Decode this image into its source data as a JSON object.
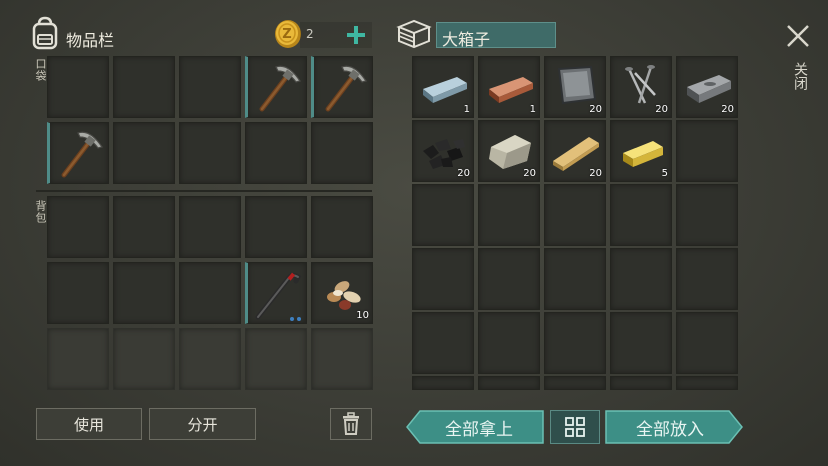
{
  "inventory": {
    "title": "物品栏",
    "coins": "2",
    "pocket_label": "口袋",
    "backpack_label": "背包",
    "pocket_slots": [
      {
        "item": "",
        "count": ""
      },
      {
        "item": "",
        "count": ""
      },
      {
        "item": "",
        "count": ""
      },
      {
        "item": "pickaxe",
        "count": ""
      },
      {
        "item": "pickaxe",
        "count": ""
      },
      {
        "item": "pickaxe",
        "count": ""
      },
      {
        "item": "",
        "count": ""
      },
      {
        "item": "",
        "count": ""
      },
      {
        "item": "",
        "count": ""
      },
      {
        "item": "",
        "count": ""
      }
    ],
    "backpack_slots": [
      {
        "item": "",
        "count": ""
      },
      {
        "item": "",
        "count": ""
      },
      {
        "item": "",
        "count": ""
      },
      {
        "item": "",
        "count": ""
      },
      {
        "item": "",
        "count": ""
      },
      {
        "item": "",
        "count": ""
      },
      {
        "item": "",
        "count": ""
      },
      {
        "item": "",
        "count": ""
      },
      {
        "item": "crowbar",
        "count": ""
      },
      {
        "item": "seeds",
        "count": "10"
      }
    ],
    "use_button": "使用",
    "split_button": "分开"
  },
  "chest": {
    "title": "大箱子",
    "close_label": "关闭",
    "slots": [
      {
        "item": "aluminum-ingot",
        "count": "1"
      },
      {
        "item": "copper-ingot",
        "count": "1"
      },
      {
        "item": "metal-plate",
        "count": "20"
      },
      {
        "item": "nails",
        "count": "20"
      },
      {
        "item": "iron-ingot",
        "count": "20"
      },
      {
        "item": "coal",
        "count": "20"
      },
      {
        "item": "stone",
        "count": "20"
      },
      {
        "item": "wood-plank",
        "count": "20"
      },
      {
        "item": "gold-ingot",
        "count": "5"
      }
    ],
    "take_all_button": "全部拿上",
    "put_all_button": "全部放入"
  }
}
